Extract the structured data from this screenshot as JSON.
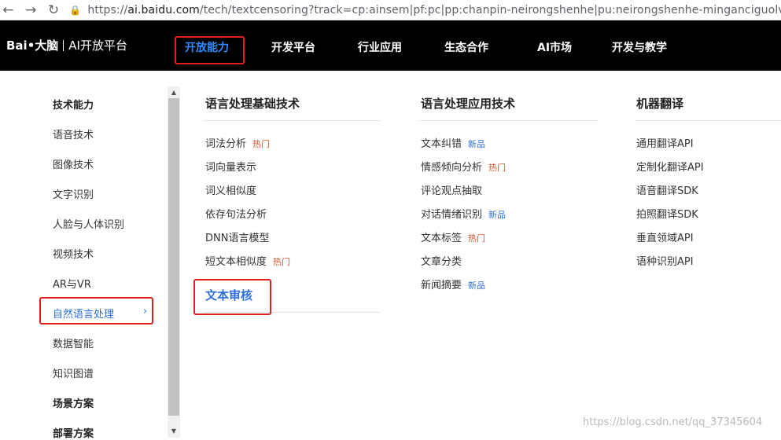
{
  "browser": {
    "url_prefix": "https://",
    "url_host": "ai.baidu.com",
    "url_rest": "/tech/textcensoring?track=cp:ainsem|pf:pc|pp:chanpin-neirongshenhe|pu:neirongshenhe-minganciguolv|ci:|kw"
  },
  "logo": {
    "brand": "Bai•大脑",
    "platform": "AI开放平台"
  },
  "topnav": {
    "items": [
      "开放能力",
      "开发平台",
      "行业应用",
      "生态合作",
      "AI市场",
      "开发与教学"
    ],
    "active": "开放能力"
  },
  "sidebar": {
    "items": [
      {
        "label": "技术能力",
        "bold": true
      },
      {
        "label": "语音技术"
      },
      {
        "label": "图像技术"
      },
      {
        "label": "文字识别"
      },
      {
        "label": "人脸与人体识别"
      },
      {
        "label": "视频技术"
      },
      {
        "label": "AR与VR"
      },
      {
        "label": "自然语言处理",
        "active": true
      },
      {
        "label": "数据智能"
      },
      {
        "label": "知识图谱"
      },
      {
        "label": "场景方案",
        "bold": true
      },
      {
        "label": "部署方案",
        "bold": true
      }
    ]
  },
  "columns": [
    {
      "title": "语言处理基础技术",
      "items": [
        {
          "label": "词法分析",
          "tag": "热门",
          "tag_type": "hot"
        },
        {
          "label": "词向量表示"
        },
        {
          "label": "词义相似度"
        },
        {
          "label": "依存句法分析"
        },
        {
          "label": "DNN语言模型"
        },
        {
          "label": "短文本相似度",
          "tag": "热门",
          "tag_type": "hot"
        }
      ]
    },
    {
      "title": "语言处理应用技术",
      "items": [
        {
          "label": "文本纠错",
          "tag": "新品",
          "tag_type": "new"
        },
        {
          "label": "情感倾向分析",
          "tag": "热门",
          "tag_type": "hot"
        },
        {
          "label": "评论观点抽取"
        },
        {
          "label": "对话情绪识别",
          "tag": "新品",
          "tag_type": "new"
        },
        {
          "label": "文本标签",
          "tag": "热门",
          "tag_type": "hot"
        },
        {
          "label": "文章分类"
        },
        {
          "label": "新闻摘要",
          "tag": "新品",
          "tag_type": "new"
        }
      ]
    },
    {
      "title": "机器翻译",
      "items": [
        {
          "label": "通用翻译API"
        },
        {
          "label": "定制化翻译API"
        },
        {
          "label": "语音翻译SDK"
        },
        {
          "label": "拍照翻译SDK"
        },
        {
          "label": "垂直领域API"
        },
        {
          "label": "语种识别API"
        }
      ]
    }
  ],
  "highlight_section": "文本审核",
  "watermark": "https://blog.csdn.net/qq_37345604",
  "colors": {
    "nav_bg": "#000000",
    "accent": "#2d6fdc",
    "hot": "#e05028",
    "annotation_red": "#e02020"
  }
}
